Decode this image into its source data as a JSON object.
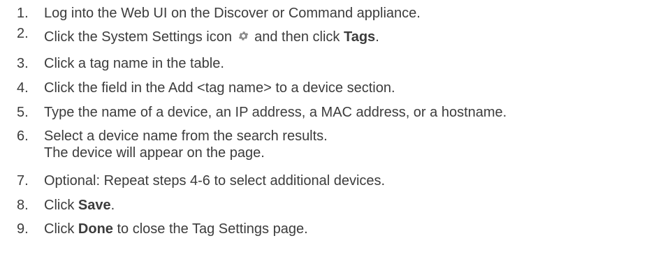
{
  "steps": [
    {
      "num": "1.",
      "parts": [
        "Log into the Web UI on the Discover or Command appliance."
      ]
    },
    {
      "num": "2.",
      "pre": "Click the System Settings icon",
      "mid": "and then click",
      "bold": "Tags",
      "post": ".",
      "icon": "gear-icon"
    },
    {
      "num": "3.",
      "parts": [
        "Click a tag name in the table."
      ]
    },
    {
      "num": "4.",
      "parts": [
        "Click the field in the Add <tag name> to a device section."
      ]
    },
    {
      "num": "5.",
      "parts": [
        "Type the name of a device, an IP address, a MAC address, or a hostname."
      ]
    },
    {
      "num": "6.",
      "line1": "Select a device name from the search results.",
      "line2": "The device will appear on the page."
    },
    {
      "num": "7.",
      "parts": [
        "Optional: Repeat steps 4-6 to select additional devices."
      ]
    },
    {
      "num": "8.",
      "pre": "Click",
      "bold": "Save",
      "post": "."
    },
    {
      "num": "9.",
      "pre": "Click",
      "bold": "Done",
      "post": "to close the Tag Settings page."
    }
  ],
  "colors": {
    "text": "#3c3c3c",
    "icon": "#8a8a8a"
  }
}
